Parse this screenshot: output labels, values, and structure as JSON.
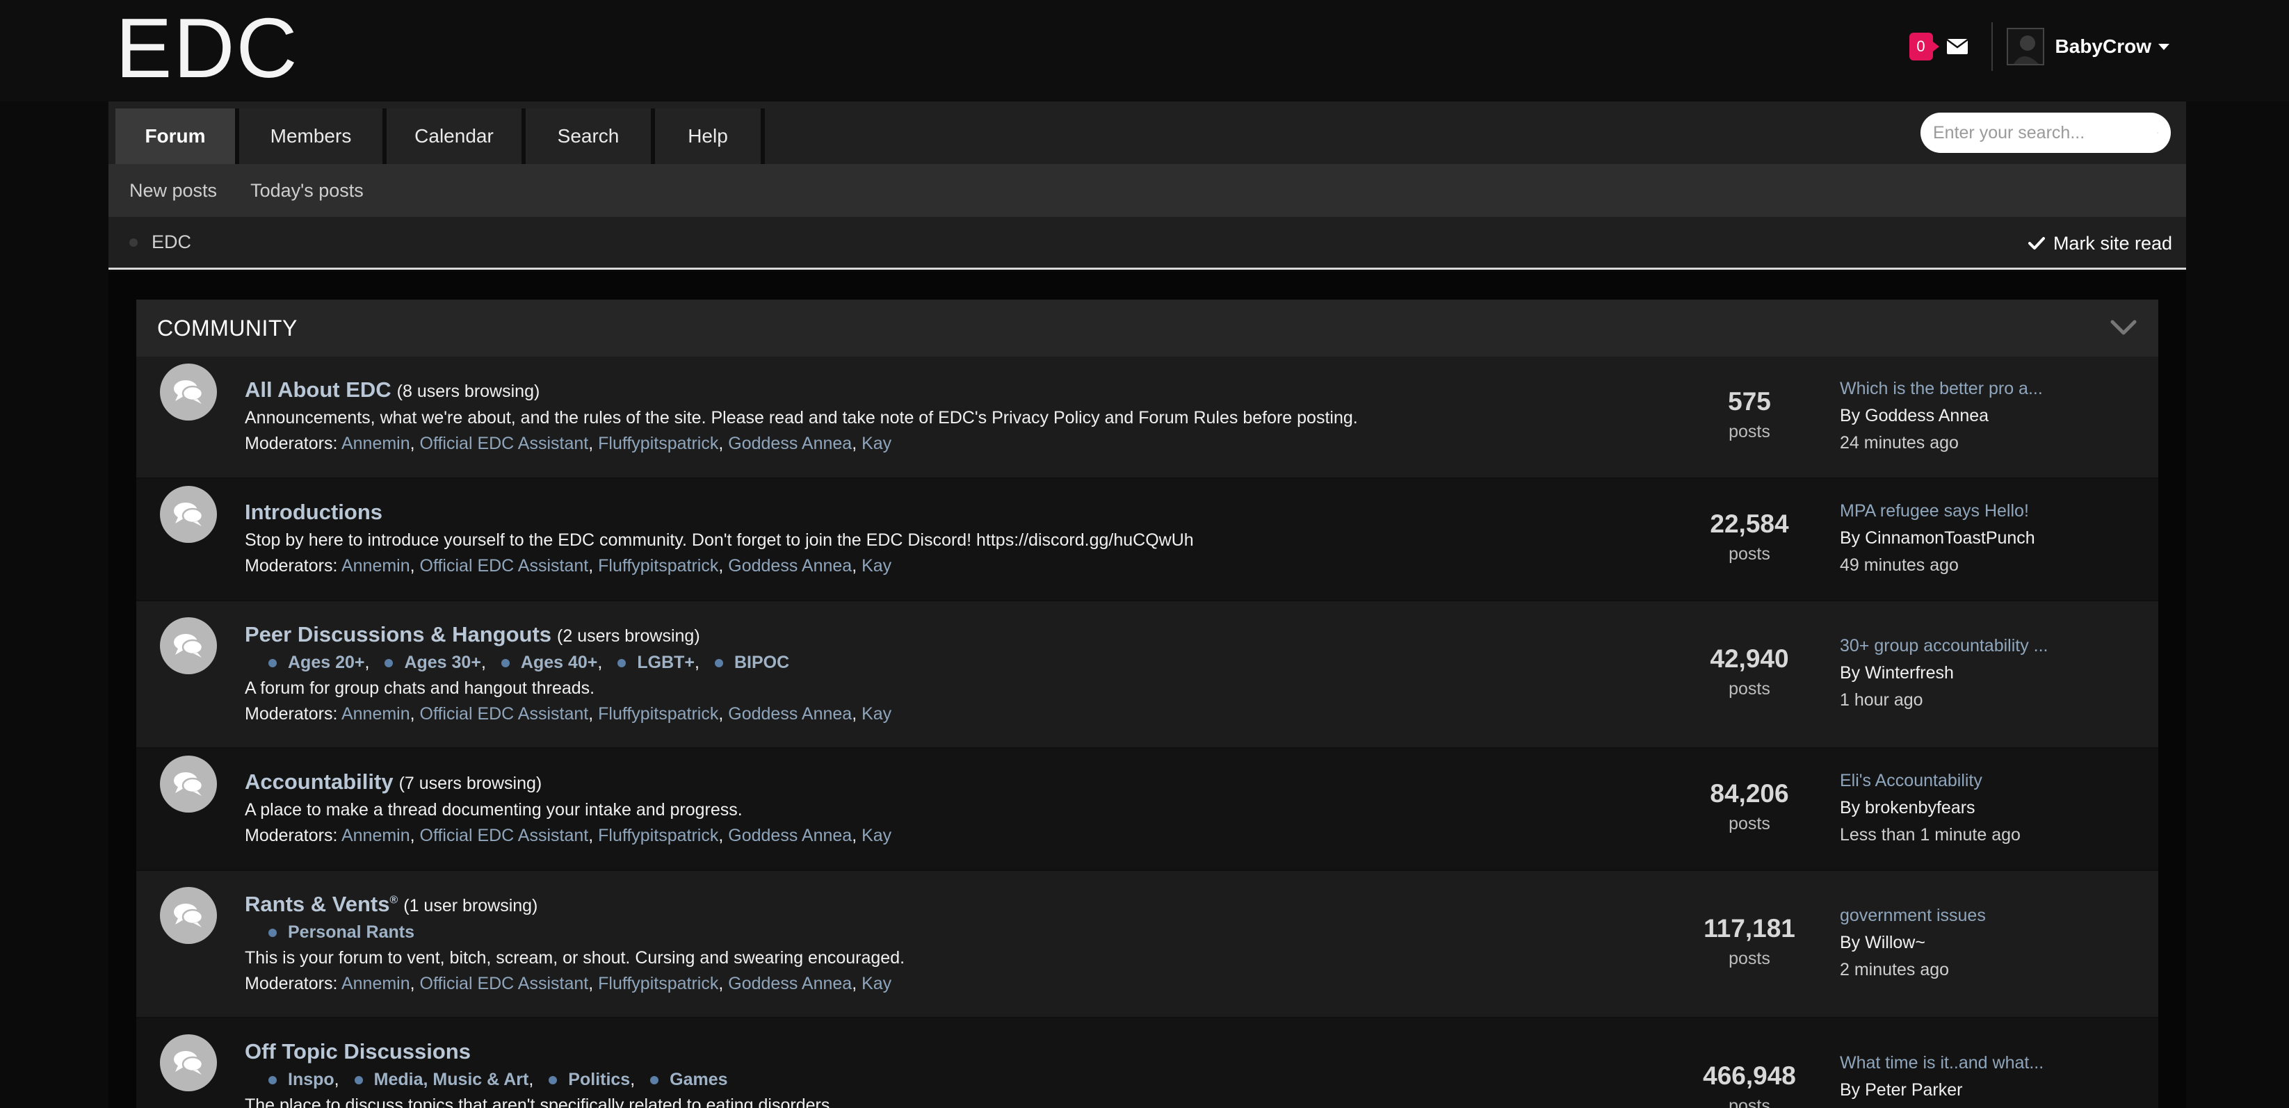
{
  "site": {
    "logo": "EDC"
  },
  "user": {
    "notifications": "0",
    "username": "BabyCrow"
  },
  "nav": {
    "tabs": [
      "Forum",
      "Members",
      "Calendar",
      "Search",
      "Help"
    ],
    "search_placeholder": "Enter your search..."
  },
  "subnav": {
    "links": [
      "New posts",
      "Today's posts"
    ]
  },
  "breadcrumb": {
    "root": "EDC",
    "mark_read": "Mark site read"
  },
  "category": {
    "title": "COMMUNITY",
    "forums": [
      {
        "title": "All About EDC",
        "title_sup": "",
        "browsing": "(8 users browsing)",
        "description": "Announcements, what we're about, and the rules of the site. Please read and take note of EDC's Privacy Policy and Forum Rules before posting.",
        "subforums": [],
        "moderators_label": "Moderators:",
        "moderators": [
          "Annemin",
          "Official EDC Assistant",
          "Fluffypitspatrick",
          "Goddess Annea",
          "Kay"
        ],
        "posts": "575",
        "posts_label": "posts",
        "last_title": "Which is the better pro a...",
        "last_by": "By Goddess Annea",
        "last_time": "24 minutes ago"
      },
      {
        "title": "Introductions",
        "title_sup": "",
        "browsing": "",
        "description": "Stop by here to introduce yourself to the EDC community. Don't forget to join the EDC Discord! https://discord.gg/huCQwUh",
        "subforums": [],
        "moderators_label": "Moderators:",
        "moderators": [
          "Annemin",
          "Official EDC Assistant",
          "Fluffypitspatrick",
          "Goddess Annea",
          "Kay"
        ],
        "posts": "22,584",
        "posts_label": "posts",
        "last_title": "MPA refugee says Hello!",
        "last_by": "By CinnamonToastPunch",
        "last_time": "49 minutes ago"
      },
      {
        "title": "Peer Discussions & Hangouts",
        "title_sup": "",
        "browsing": "(2 users browsing)",
        "description": "A forum for group chats and hangout threads.",
        "subforums": [
          "Ages 20+",
          "Ages 30+",
          "Ages 40+",
          "LGBT+",
          "BIPOC"
        ],
        "moderators_label": "Moderators:",
        "moderators": [
          "Annemin",
          "Official EDC Assistant",
          "Fluffypitspatrick",
          "Goddess Annea",
          "Kay"
        ],
        "posts": "42,940",
        "posts_label": "posts",
        "last_title": "30+ group accountability ...",
        "last_by": "By Winterfresh",
        "last_time": "1 hour ago"
      },
      {
        "title": "Accountability",
        "title_sup": "",
        "browsing": "(7 users browsing)",
        "description": "A place to make a thread documenting your intake and progress.",
        "subforums": [],
        "moderators_label": "Moderators:",
        "moderators": [
          "Annemin",
          "Official EDC Assistant",
          "Fluffypitspatrick",
          "Goddess Annea",
          "Kay"
        ],
        "posts": "84,206",
        "posts_label": "posts",
        "last_title": "Eli's Accountability",
        "last_by": "By brokenbyfears",
        "last_time": "Less than 1 minute ago"
      },
      {
        "title": "Rants & Vents",
        "title_sup": "®",
        "browsing": "(1 user browsing)",
        "description": "This is your forum to vent, bitch, scream, or shout. Cursing and swearing encouraged.",
        "subforums": [
          "Personal Rants"
        ],
        "moderators_label": "Moderators:",
        "moderators": [
          "Annemin",
          "Official EDC Assistant",
          "Fluffypitspatrick",
          "Goddess Annea",
          "Kay"
        ],
        "posts": "117,181",
        "posts_label": "posts",
        "last_title": "government issues",
        "last_by": "By Willow~",
        "last_time": "2 minutes ago"
      },
      {
        "title": "Off Topic Discussions",
        "title_sup": "",
        "browsing": "",
        "description": "The place to discuss topics that aren't specifically related to eating disorders.",
        "subforums": [
          "Inspo",
          "Media, Music & Art",
          "Politics",
          "Games"
        ],
        "moderators_label": "Moderators:",
        "moderators": [],
        "posts": "466,948",
        "posts_label": "posts",
        "last_title": "What time is it..and what...",
        "last_by": "By Peter Parker",
        "last_time": ""
      }
    ]
  }
}
